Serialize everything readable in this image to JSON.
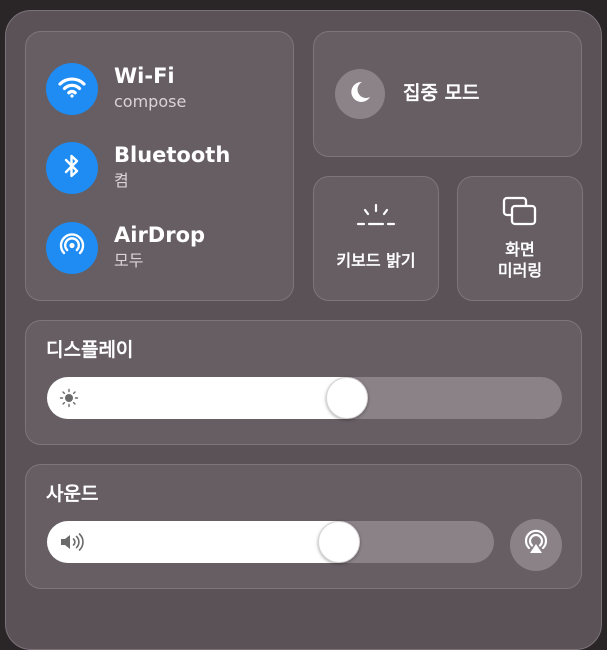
{
  "network": {
    "wifi": {
      "title": "Wi-Fi",
      "subtitle": "compose",
      "icon": "wifi-icon"
    },
    "bluetooth": {
      "title": "Bluetooth",
      "subtitle": "켬",
      "icon": "bluetooth-icon"
    },
    "airdrop": {
      "title": "AirDrop",
      "subtitle": "모두",
      "icon": "airdrop-icon"
    },
    "accent_color": "#1e8cf2"
  },
  "focus": {
    "label": "집중 모드",
    "icon": "moon-icon"
  },
  "keyboard_brightness": {
    "label": "키보드 밝기",
    "icon": "keyboard-brightness-icon"
  },
  "screen_mirroring": {
    "label_line1": "화면",
    "label_line2": "미러링",
    "icon": "screen-mirroring-icon"
  },
  "display": {
    "title": "디스플레이",
    "icon": "sun-icon",
    "level": 0.59
  },
  "sound": {
    "title": "사운드",
    "icon": "speaker-icon",
    "level": 0.67,
    "output_icon": "airplay-audio-icon"
  }
}
